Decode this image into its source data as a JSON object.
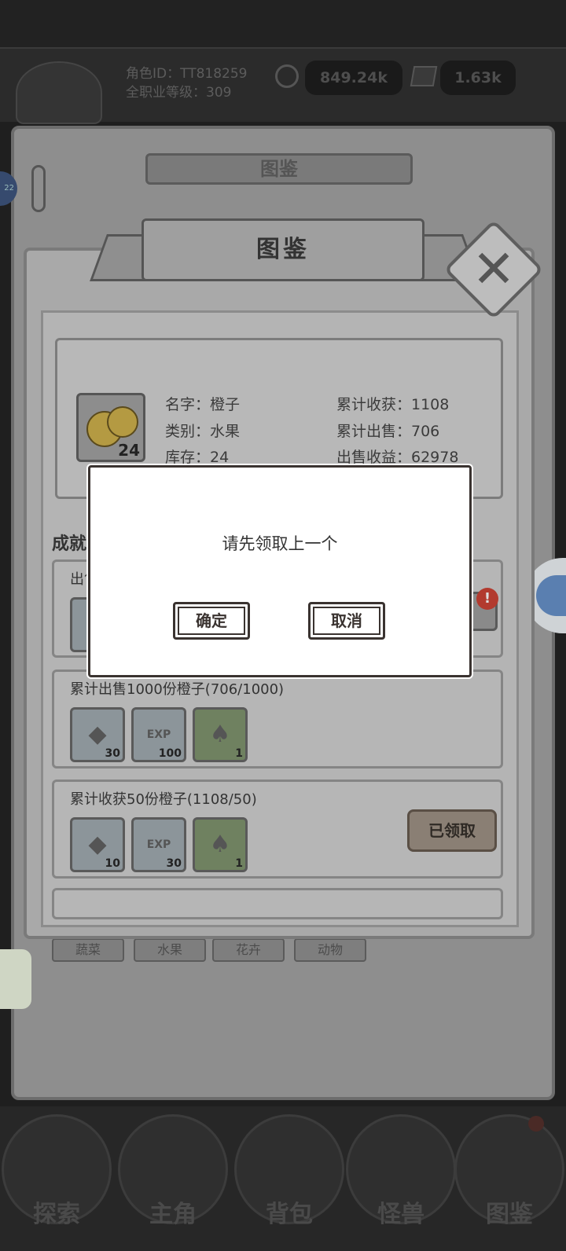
{
  "header": {
    "role_id_label": "角色ID：TT818259",
    "job_level_label": "全职业等级：309",
    "coins": "849.24k",
    "gems": "1.63k"
  },
  "back_page": {
    "title": "图鉴",
    "categories": [
      "蔬菜",
      "水果",
      "花卉",
      "动物"
    ]
  },
  "book": {
    "title": "图鉴",
    "item": {
      "name_label": "名字：橙子",
      "type_label": "类别：水果",
      "stock_label": "库存：24",
      "stock_count": "24",
      "total_harvest_label": "累计收获：1108",
      "total_sold_label": "累计出售：706",
      "sale_income_label": "出售收益：62978"
    },
    "achievements_title": "成就",
    "achievements": [
      {
        "label": "出售"
      },
      {
        "label": "累计出售1000份橙子(706/1000)",
        "rewards": [
          {
            "icon": "stone-icon",
            "count": "30"
          },
          {
            "icon": "exp-book-icon",
            "count": "100"
          },
          {
            "icon": "leaf-icon",
            "count": "1"
          }
        ]
      },
      {
        "label": "累计收获50份橙子(1108/50)",
        "rewards": [
          {
            "icon": "stone-icon",
            "count": "10"
          },
          {
            "icon": "exp-book-icon",
            "count": "30"
          },
          {
            "icon": "leaf-icon",
            "count": "1"
          }
        ],
        "status": "已领取"
      }
    ],
    "alert_badge": "!"
  },
  "bottom_nav": [
    "探索",
    "主角",
    "背包",
    "怪兽",
    "图鉴"
  ],
  "dialog": {
    "message": "请先领取上一个",
    "confirm": "确定",
    "cancel": "取消"
  },
  "colors": {
    "dialog_bg": "#ffffff",
    "dialog_border": "#3a3330",
    "alert": "#b23a2e"
  }
}
